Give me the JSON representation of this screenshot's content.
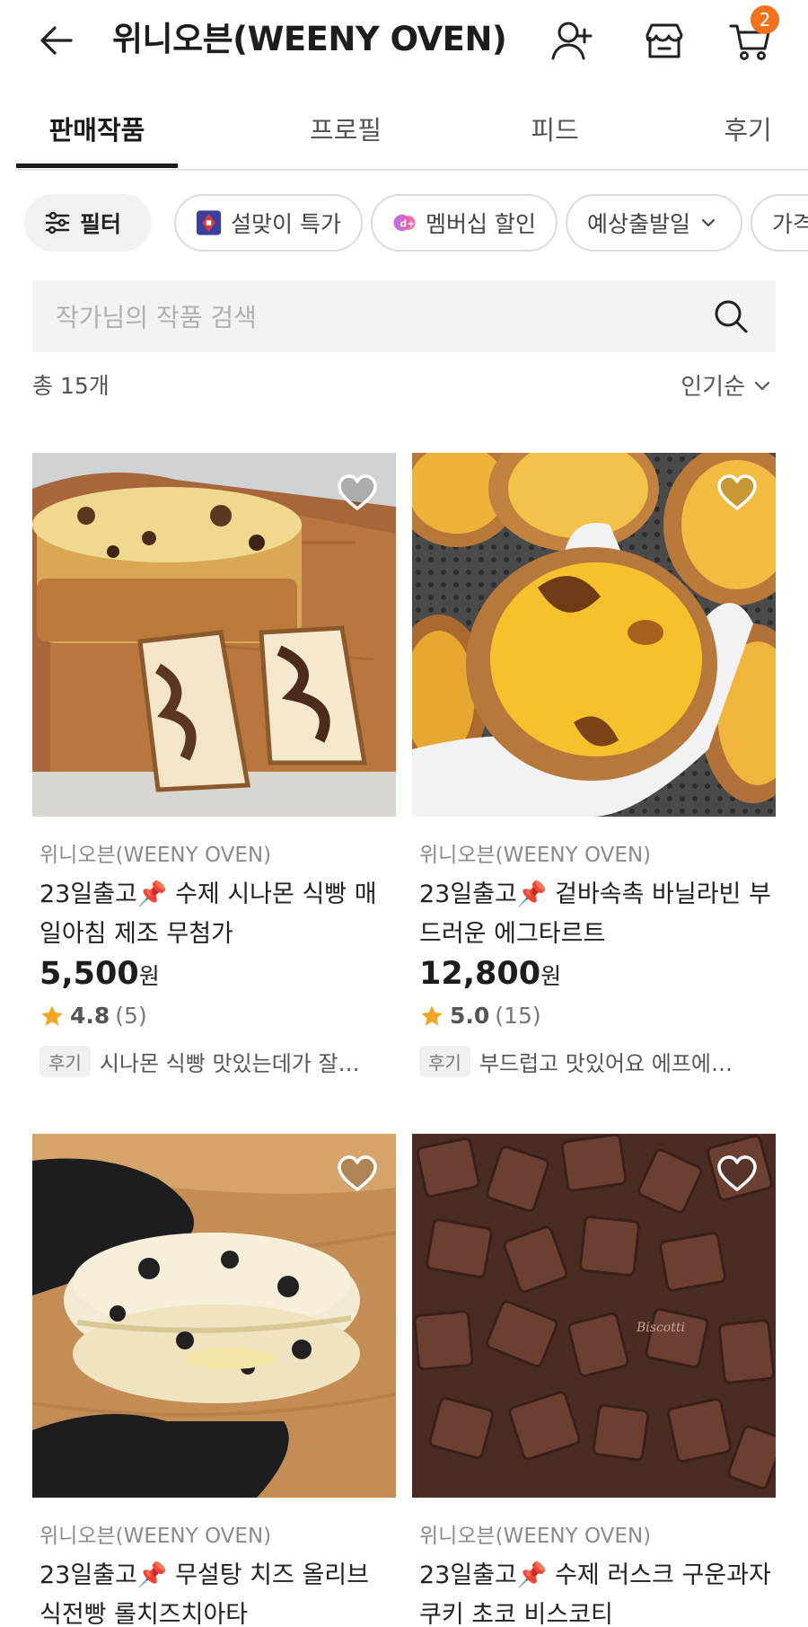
{
  "header": {
    "title": "위니오븐(WEENY OVEN)",
    "cart_count": "2"
  },
  "tabs": [
    "판매작품",
    "프로필",
    "피드",
    "후기"
  ],
  "chips": {
    "filter": "필터",
    "event": "설맞이 특가",
    "membership": "멤버십 할인",
    "ship_date": "예상출발일",
    "price": "가격"
  },
  "search": {
    "placeholder": "작가님의 작품 검색"
  },
  "summary": {
    "count": "총 15개",
    "sort": "인기순"
  },
  "review_tag": "후기",
  "colors": {
    "accent": "#f2711c",
    "star": "#f5a623"
  },
  "products": [
    {
      "shop": "위니오븐(WEENY OVEN)",
      "name": "23일출고📌 수제 시나몬 식빵 매일아침 제조 무첨가",
      "price": "5,500",
      "won": "원",
      "rating": "4.8",
      "reviews": "(5)",
      "review_text": "시나몬 식빵 맛있는데가 잘…"
    },
    {
      "shop": "위니오븐(WEENY OVEN)",
      "name": "23일출고📌 겉바속촉 바닐라빈 부드러운 에그타르트",
      "price": "12,800",
      "won": "원",
      "rating": "5.0",
      "reviews": "(15)",
      "review_text": "부드럽고 맛있어요 에프에…"
    },
    {
      "shop": "위니오븐(WEENY OVEN)",
      "name": "23일출고📌 무설탕 치즈 올리브 식전빵 롤치즈치아타"
    },
    {
      "shop": "위니오븐(WEENY OVEN)",
      "name": "23일출고📌 수제 러스크 구운과자 쿠키 초코 비스코티",
      "watermark": "Biscotti"
    }
  ]
}
